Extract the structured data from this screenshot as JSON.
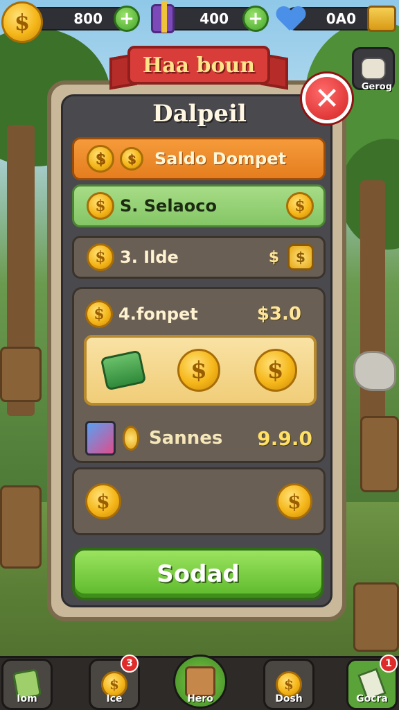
{
  "hud": {
    "coins_value": "800",
    "gems_value": "400",
    "hearts_value": "0A0",
    "coin_symbol": "$",
    "plus_symbol": "+",
    "side_label": "Gerog"
  },
  "panel": {
    "ribbon_title": "Haa boun",
    "title": "Dalpeil",
    "close_symbol": "✕"
  },
  "rows": {
    "row1_label": "Saldo Dompet",
    "row2_label": "S. Selaoco",
    "row3_label": "3. Ilde",
    "row3_value": "$",
    "group_label": "4.fonpet",
    "group_value": "$3.0",
    "footer_label": "Sannes",
    "footer_value": "9.9.0"
  },
  "button": {
    "label": "Sodad"
  },
  "nav": {
    "items": [
      {
        "label": "Iom"
      },
      {
        "label": "Ice",
        "badge": "3"
      },
      {
        "label": "Hero"
      },
      {
        "label": "Dosh"
      },
      {
        "label": "Gocra",
        "badge": "1"
      }
    ]
  }
}
